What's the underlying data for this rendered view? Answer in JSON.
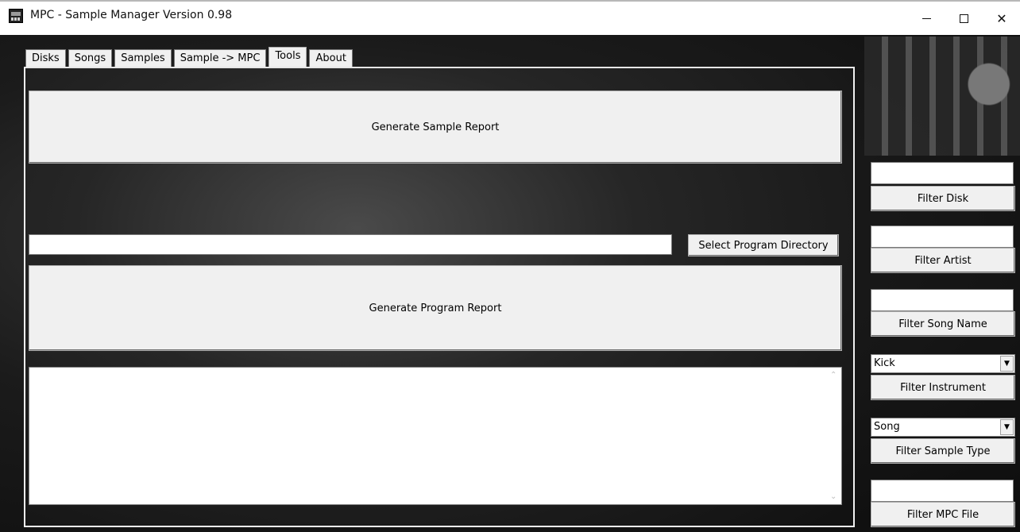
{
  "window": {
    "title": "MPC - Sample Manager Version 0.98",
    "minimize_glyph": "—",
    "close_glyph": "✕"
  },
  "tabs": [
    {
      "label": "Disks",
      "active": false
    },
    {
      "label": "Songs",
      "active": false
    },
    {
      "label": "Samples",
      "active": false
    },
    {
      "label": "Sample -> MPC",
      "active": false
    },
    {
      "label": "Tools",
      "active": true
    },
    {
      "label": "About",
      "active": false
    }
  ],
  "tools": {
    "generate_sample_report": "Generate Sample Report",
    "program_directory_value": "",
    "select_program_directory": "Select Program Directory",
    "generate_program_report": "Generate Program Report",
    "output_text": ""
  },
  "filters": {
    "disk": {
      "value": "",
      "button": "Filter Disk"
    },
    "artist": {
      "value": "",
      "button": "Filter Artist"
    },
    "song_name": {
      "value": "",
      "button": "Filter Song Name"
    },
    "instrument": {
      "selected": "Kick",
      "button": "Filter Instrument"
    },
    "sample_type": {
      "selected": "Song",
      "button": "Filter Sample Type"
    },
    "mpc_file": {
      "value": "",
      "button": "Filter MPC File"
    }
  },
  "icons": {
    "app": "mpc-app-icon",
    "dropdown": "chevron-down-icon"
  }
}
